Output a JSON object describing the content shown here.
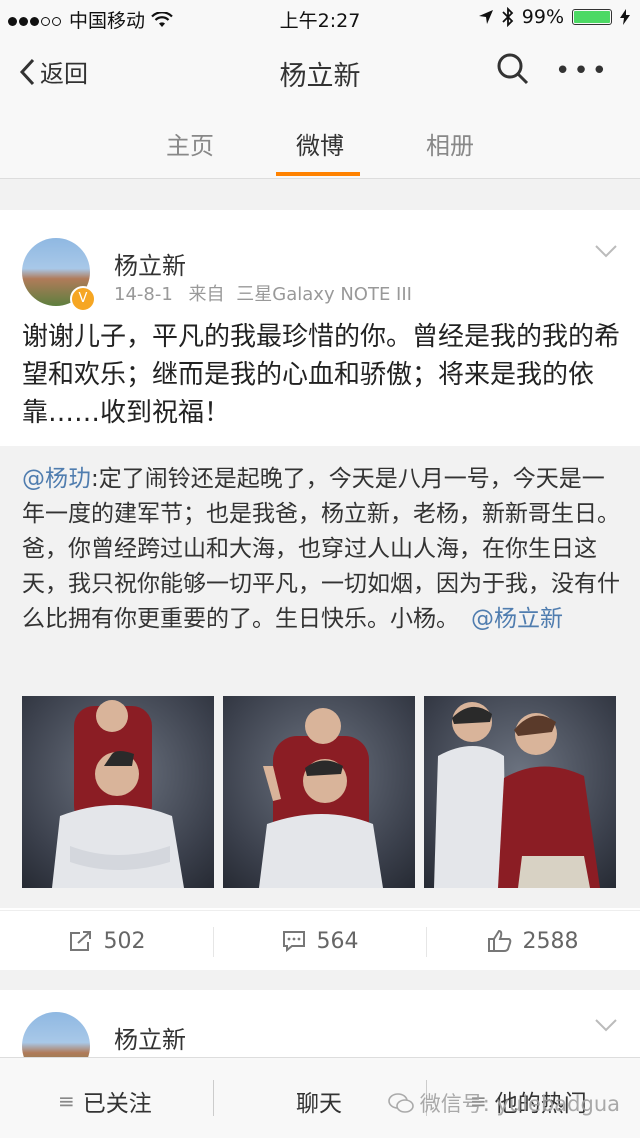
{
  "status_bar": {
    "carrier": "中国移动",
    "time": "上午2:27",
    "battery": "99%",
    "battery_level": 0.99
  },
  "nav": {
    "back_label": "返回",
    "title": "杨立新"
  },
  "tabs": [
    {
      "label": "主页"
    },
    {
      "label": "微博"
    },
    {
      "label": "相册"
    }
  ],
  "post": {
    "user_name": "杨立新",
    "date": "14-8-1",
    "source_prefix": "来自",
    "source": "三星Galaxy NOTE III",
    "text": "谢谢儿子，平凡的我最珍惜的你。曾经是我的我的希望和欢乐；继而是我的心血和骄傲；将来是我的依靠……收到祝福！",
    "repost": {
      "mention": "@杨玏",
      "text": ":定了闹铃还是起晚了，今天是八月一号，今天是一年一度的建军节；也是我爸，杨立新，老杨，新新哥生日。爸，你曾经跨过山和大海，也穿过人山人海，在你生日这天，我只祝你能够一切平凡，一切如烟，因为于我，没有什么比拥有你更重要的了。生日快乐。小杨。",
      "end_mention": "@杨立新"
    },
    "actions": {
      "reposts": "502",
      "comments": "564",
      "likes": "2588"
    }
  },
  "next_post": {
    "user_name": "杨立新"
  },
  "bottom_bar": {
    "follow_label": "已关注",
    "chat_label": "聊天",
    "hot_label": "他的热门",
    "watermark": "微信号: yulebadgua"
  }
}
